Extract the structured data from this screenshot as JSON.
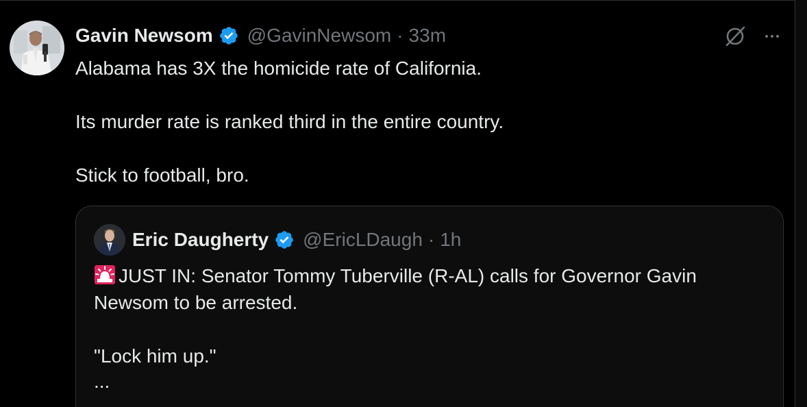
{
  "colors": {
    "background": "#000000",
    "text_primary": "#e7e9ea",
    "text_secondary": "#71767b",
    "border": "#2f3336",
    "verified_blue": "#1d9bf0",
    "siren_red": "#e0245e"
  },
  "tweet": {
    "author": {
      "display_name": "Gavin Newsom",
      "handle": "@GavinNewsom",
      "verified_icon": "verified-badge-icon",
      "avatar_icon": "avatar"
    },
    "separator": "·",
    "time": "33m",
    "icons": {
      "grok": "grok-icon",
      "more": "more-icon"
    },
    "paragraphs": [
      "Alabama has 3X the homicide rate of California.",
      "Its murder rate is ranked third in the entire country.",
      "Stick to football, bro."
    ]
  },
  "quoted_tweet": {
    "author": {
      "display_name": "Eric Daugherty",
      "handle": "@EricLDaugh",
      "verified_icon": "verified-badge-icon"
    },
    "separator": "·",
    "time": "1h",
    "siren_icon": "siren-emoji-icon",
    "line1": "JUST IN: Senator Tommy Tuberville (R-AL) calls for Governor Gavin Newsom to be arrested.",
    "line2": "\"Lock him up.\"",
    "truncation": "..."
  }
}
